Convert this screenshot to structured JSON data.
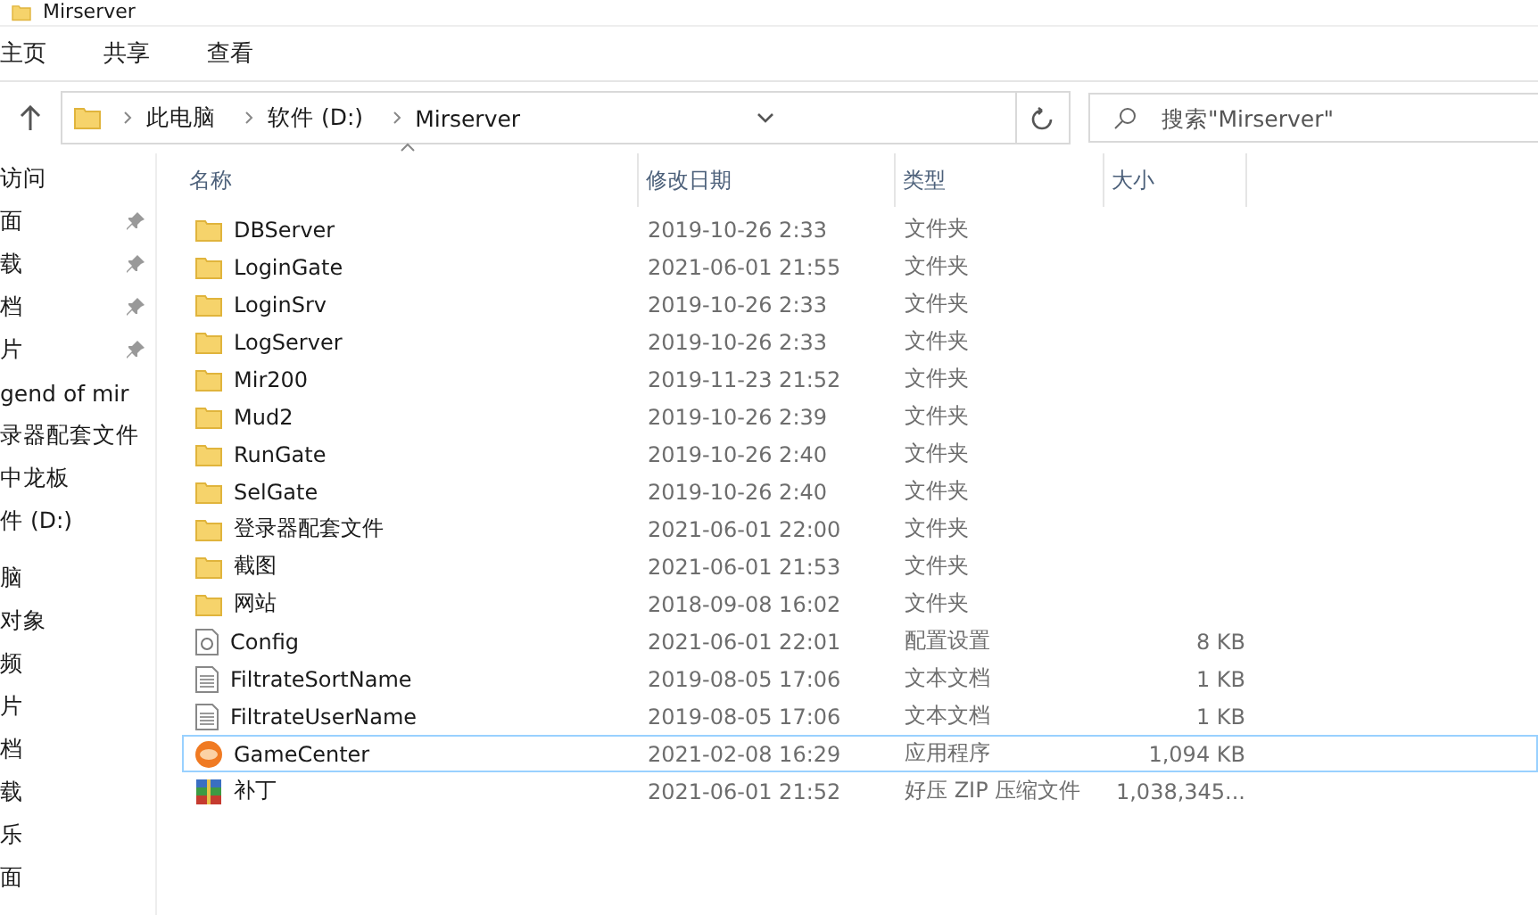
{
  "window": {
    "title": "Mirserver"
  },
  "ribbon_tabs": [
    {
      "label": "主页",
      "selected": false
    },
    {
      "label": "共享",
      "selected": false
    },
    {
      "label": "查看",
      "selected": false
    }
  ],
  "address": {
    "crumbs": [
      "此电脑",
      "软件 (D:)",
      "Mirserver"
    ]
  },
  "search": {
    "placeholder": "搜索\"Mirserver\""
  },
  "sidebar": {
    "items": [
      {
        "label": "访问",
        "pinned": false
      },
      {
        "label": "面",
        "pinned": true
      },
      {
        "label": "载",
        "pinned": true
      },
      {
        "label": "档",
        "pinned": true
      },
      {
        "label": "片",
        "pinned": true
      },
      {
        "label": "gend of mir",
        "pinned": false
      },
      {
        "label": "录器配套文件",
        "pinned": false
      },
      {
        "label": "中龙板",
        "pinned": false
      },
      {
        "label": "件 (D:)",
        "pinned": false
      },
      {
        "label": "脑",
        "pinned": false
      },
      {
        "label": "对象",
        "pinned": false
      },
      {
        "label": "频",
        "pinned": false
      },
      {
        "label": "片",
        "pinned": false
      },
      {
        "label": "档",
        "pinned": false
      },
      {
        "label": "载",
        "pinned": false
      },
      {
        "label": "乐",
        "pinned": false
      },
      {
        "label": "面",
        "pinned": false
      }
    ]
  },
  "table": {
    "columns": [
      "名称",
      "修改日期",
      "类型",
      "大小"
    ],
    "rows": [
      {
        "kind": "folder",
        "name": "DBServer",
        "date": "2019-10-26 2:33",
        "type": "文件夹",
        "size": "",
        "selected": false
      },
      {
        "kind": "folder",
        "name": "LoginGate",
        "date": "2021-06-01 21:55",
        "type": "文件夹",
        "size": "",
        "selected": false
      },
      {
        "kind": "folder",
        "name": "LoginSrv",
        "date": "2019-10-26 2:33",
        "type": "文件夹",
        "size": "",
        "selected": false
      },
      {
        "kind": "folder",
        "name": "LogServer",
        "date": "2019-10-26 2:33",
        "type": "文件夹",
        "size": "",
        "selected": false
      },
      {
        "kind": "folder",
        "name": "Mir200",
        "date": "2019-11-23 21:52",
        "type": "文件夹",
        "size": "",
        "selected": false
      },
      {
        "kind": "folder",
        "name": "Mud2",
        "date": "2019-10-26 2:39",
        "type": "文件夹",
        "size": "",
        "selected": false
      },
      {
        "kind": "folder",
        "name": "RunGate",
        "date": "2019-10-26 2:40",
        "type": "文件夹",
        "size": "",
        "selected": false
      },
      {
        "kind": "folder",
        "name": "SelGate",
        "date": "2019-10-26 2:40",
        "type": "文件夹",
        "size": "",
        "selected": false
      },
      {
        "kind": "folder",
        "name": "登录器配套文件",
        "date": "2021-06-01 22:00",
        "type": "文件夹",
        "size": "",
        "selected": false
      },
      {
        "kind": "folder",
        "name": "截图",
        "date": "2021-06-01 21:53",
        "type": "文件夹",
        "size": "",
        "selected": false
      },
      {
        "kind": "folder",
        "name": "网站",
        "date": "2018-09-08 16:02",
        "type": "文件夹",
        "size": "",
        "selected": false
      },
      {
        "kind": "config",
        "name": "Config",
        "date": "2021-06-01 22:01",
        "type": "配置设置",
        "size": "8 KB",
        "selected": false
      },
      {
        "kind": "text",
        "name": "FiltrateSortName",
        "date": "2019-08-05 17:06",
        "type": "文本文档",
        "size": "1 KB",
        "selected": false
      },
      {
        "kind": "text",
        "name": "FiltrateUserName",
        "date": "2019-08-05 17:06",
        "type": "文本文档",
        "size": "1 KB",
        "selected": false
      },
      {
        "kind": "app",
        "name": "GameCenter",
        "date": "2021-02-08 16:29",
        "type": "应用程序",
        "size": "1,094 KB",
        "selected": true
      },
      {
        "kind": "zip",
        "name": "补丁",
        "date": "2021-06-01 21:52",
        "type": "好压 ZIP 压缩文件",
        "size": "1,038,345...",
        "selected": false
      }
    ]
  }
}
